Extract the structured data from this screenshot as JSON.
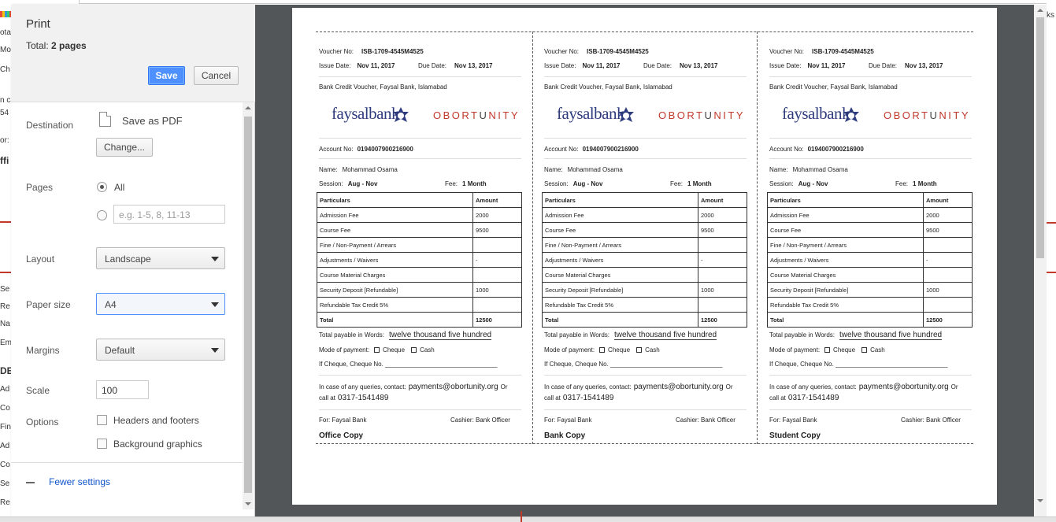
{
  "dialog": {
    "title": "Print",
    "total_label": "Total:",
    "total_value": "2 pages",
    "save_label": "Save",
    "cancel_label": "Cancel",
    "destination_label": "Destination",
    "destination_value": "Save as PDF",
    "change_label": "Change...",
    "pages_label": "Pages",
    "pages_all": "All",
    "pages_placeholder": "e.g. 1-5, 8, 11-13",
    "layout_label": "Layout",
    "layout_value": "Landscape",
    "paper_label": "Paper size",
    "paper_value": "A4",
    "margins_label": "Margins",
    "margins_value": "Default",
    "scale_label": "Scale",
    "scale_value": "100",
    "options_label": "Options",
    "headers_footers": "Headers and footers",
    "background_graphics": "Background graphics",
    "fewer_settings": "Fewer settings"
  },
  "voucher": {
    "voucher_no_label": "Voucher No:",
    "voucher_no": "ISB-1709-4545M4525",
    "issue_label": "Issue Date:",
    "issue_date": "Nov 11, 2017",
    "due_label": "Due Date:",
    "due_date": "Nov 13, 2017",
    "bank_line": "Bank Credit Voucher, Faysal Bank, Islamabad",
    "logo_bank": "faysalbank",
    "logo_brand_a": "OBORT",
    "logo_brand_b": "U",
    "logo_brand_c": "NITY",
    "account_label": "Account No:",
    "account_no": "0194007900216900",
    "name_label": "Name:",
    "name": "Mohammad Osama",
    "session_label": "Session:",
    "session": "Aug - Nov",
    "fee_label": "Fee:",
    "fee": "1 Month",
    "col_particulars": "Particulars",
    "col_amount": "Amount",
    "rows": [
      {
        "label": "Admission Fee",
        "amount": "2000"
      },
      {
        "label": "Course Fee",
        "amount": "9500"
      },
      {
        "label": "Fine / Non-Payment / Arrears",
        "amount": ""
      },
      {
        "label": "Adjustments / Waivers",
        "amount": "-"
      },
      {
        "label": "Course Material Charges",
        "amount": ""
      },
      {
        "label": "Security Deposit [Refundable]",
        "amount": "1000"
      },
      {
        "label": "Refundable Tax Credit 5%",
        "amount": ""
      }
    ],
    "total_label": "Total",
    "total": "12500",
    "words_label": "Total payable in Words:",
    "words": "twelve thousand five hundred",
    "mode_label": "Mode of payment:",
    "cheque": "Cheque",
    "cash": "Cash",
    "cheque_no_label": "If Cheque, Cheque No. ________________________________",
    "queries_label": "In case of any queries, contact:",
    "email": "payments@obortunity.org",
    "or_label": "Or",
    "call_label": "call at",
    "phone": "0317-1541489",
    "for_label": "For: Faysal Bank",
    "cashier_label": "Cashier: Bank Officer",
    "copies": [
      "Office Copy",
      "Bank Copy",
      "Student Copy"
    ]
  },
  "background": {
    "fragments": [
      "ota",
      "Mod",
      "Ch",
      "n ca",
      "54",
      "or:",
      "ffi",
      "Se",
      "Re",
      "Na",
      "Em",
      "DE",
      "Ad",
      "Co",
      "Fin",
      "Ad",
      "Co",
      "Se",
      "Re"
    ],
    "right_fragment": "ks"
  },
  "colors": {
    "accent": "#4d90fe",
    "preview_bg": "#525659",
    "brand_navy": "#2e3c7e",
    "brand_red": "#c0392b"
  }
}
